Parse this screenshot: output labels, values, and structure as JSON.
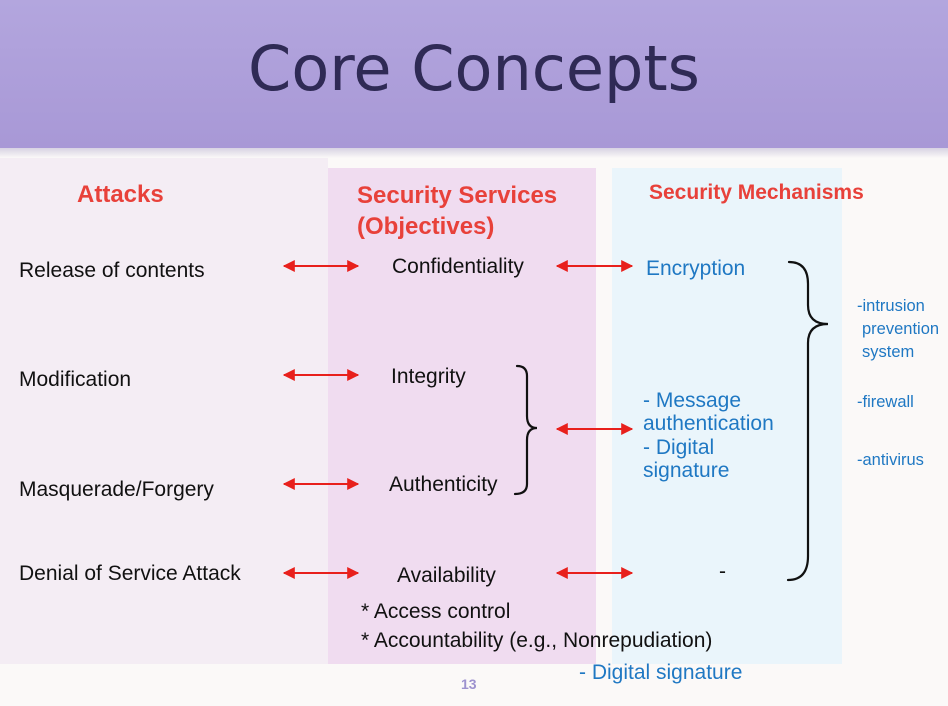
{
  "slide": {
    "title": "Core Concepts",
    "page_number": "13"
  },
  "columns": {
    "attacks_header": "Attacks",
    "services_header_line1": "Security Services",
    "services_header_line2": "(Objectives)",
    "mechanisms_header": "Security Mechanisms"
  },
  "attacks": [
    "Release of contents",
    "Modification",
    "Masquerade/Forgery",
    "Denial of Service Attack"
  ],
  "services": [
    "Confidentiality",
    "Integrity",
    "Authenticity",
    "Availability"
  ],
  "services_extra": [
    "* Access control",
    "* Accountability (e.g., Nonrepudiation)"
  ],
  "mechanisms": {
    "encryption": "Encryption",
    "msg_auth_line1": "- Message",
    "msg_auth_line2": "authentication",
    "digsig_line1": "- Digital",
    "digsig_line2": "signature",
    "availability_mech": "-",
    "accountability_mech": "- Digital signature"
  },
  "side_mechanisms": {
    "ips_line1": "-intrusion",
    "ips_line2": "prevention",
    "ips_line3": "system",
    "firewall": "-firewall",
    "antivirus": "-antivirus"
  },
  "colors": {
    "banner": "#a99bd8",
    "title": "#2f2a55",
    "header_red": "#e8413a",
    "arrow_red": "#e8201c",
    "mechanism_blue": "#1f78c3",
    "attacks_panel": "#f4edf4",
    "services_panel": "#f0dcf0",
    "mechanisms_panel": "#eaf5fb"
  }
}
